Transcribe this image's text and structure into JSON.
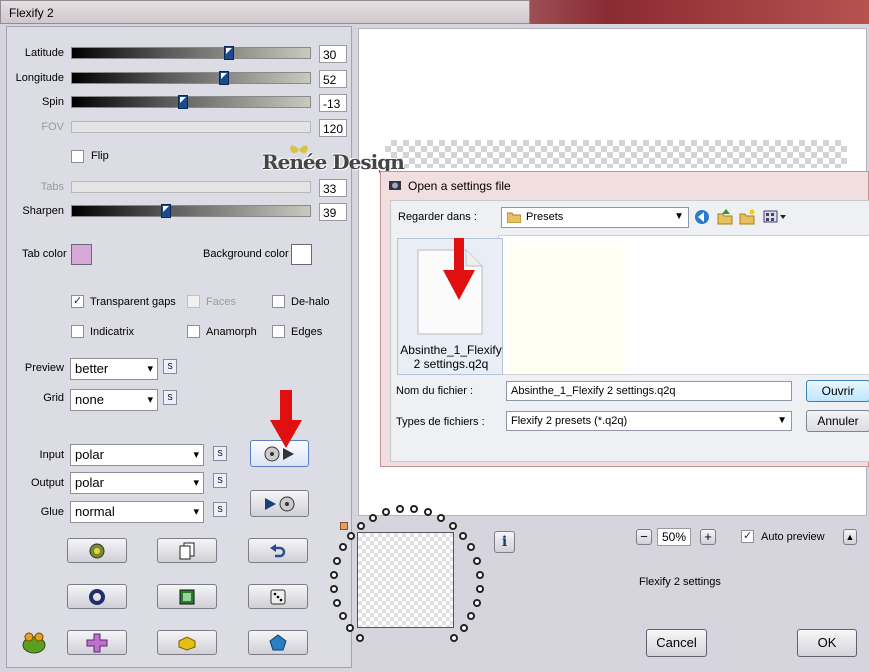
{
  "window": {
    "title": "Flexify 2"
  },
  "sliders": [
    {
      "label": "Latitude",
      "value": "30",
      "level": 0.65,
      "disabled": false
    },
    {
      "label": "Longitude",
      "value": "52",
      "level": 0.63,
      "disabled": false
    },
    {
      "label": "Spin",
      "value": "-13",
      "level": 0.46,
      "disabled": false
    },
    {
      "label": "FOV",
      "value": "120",
      "level": null,
      "disabled": true
    },
    {
      "label": "Tabs",
      "value": "33",
      "level": null,
      "disabled": true
    },
    {
      "label": "Sharpen",
      "value": "39",
      "level": 0.39,
      "disabled": false
    }
  ],
  "flip": {
    "label": "Flip"
  },
  "tab_color": {
    "label": "Tab color",
    "color": "#d8a8d8"
  },
  "background_color": {
    "label": "Background color",
    "color": "#ffffff"
  },
  "options": {
    "transparent_gaps": "Transparent gaps",
    "faces": "Faces",
    "de_halo": "De-halo",
    "indicatrix": "Indicatrix",
    "anamorph": "Anamorph",
    "edges": "Edges"
  },
  "preview": {
    "label": "Preview",
    "value": "better"
  },
  "grid": {
    "label": "Grid",
    "value": "none"
  },
  "input": {
    "label": "Input",
    "value": "polar"
  },
  "output": {
    "label": "Output",
    "value": "polar"
  },
  "glue": {
    "label": "Glue",
    "value": "normal"
  },
  "s_label": "S",
  "watermark": "Renée Design",
  "file_dialog": {
    "title": "Open a settings file",
    "look_in_label": "Regarder dans :",
    "look_in_value": "Presets",
    "file_name": "Absinthe_1_Flexify 2 settings.q2q",
    "file_name_label": "Nom du fichier :",
    "file_name_value": "Absinthe_1_Flexify 2 settings.q2q",
    "file_type_label": "Types de fichiers :",
    "file_type_value": "Flexify 2 presets (*.q2q)",
    "open_button": "Ouvrir",
    "cancel_button": "Annuler"
  },
  "zoom": {
    "value": "50%",
    "minus": "−",
    "plus": "+"
  },
  "auto_preview": {
    "label": "Auto preview",
    "checked": true
  },
  "settings_name": "Flexify 2 settings",
  "info_label": "i",
  "cancel_label": "Cancel",
  "ok_label": "OK",
  "colors": {
    "accent_red": "#e01010",
    "thumb_blue": "#1a4b8c"
  }
}
